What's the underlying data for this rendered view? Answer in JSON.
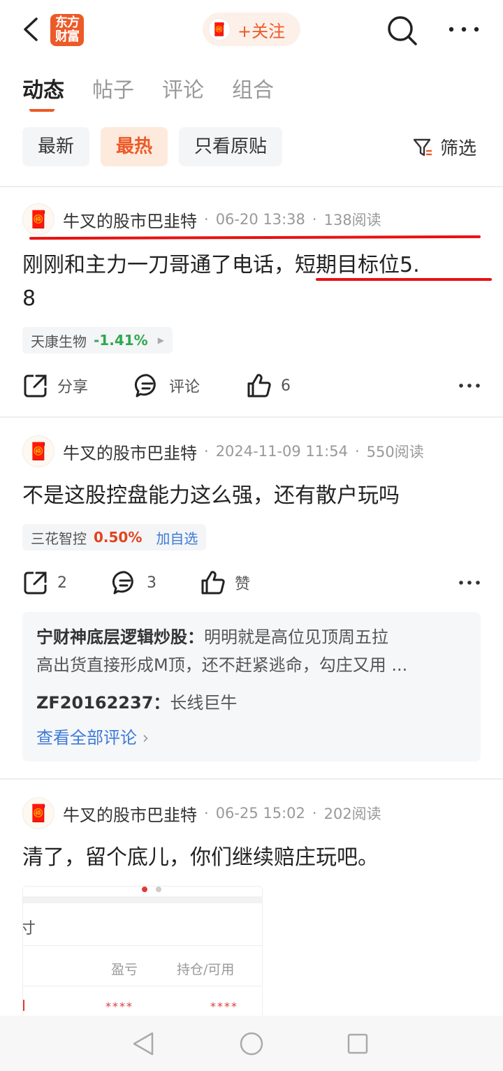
{
  "header": {
    "logo_text": "东方财富",
    "follow_label": "+关注"
  },
  "tabs": [
    {
      "label": "动态"
    },
    {
      "label": "帖子"
    },
    {
      "label": "评论"
    },
    {
      "label": "组合"
    }
  ],
  "filters": {
    "chips": [
      {
        "label": "最新"
      },
      {
        "label": "最热"
      },
      {
        "label": "只看原贴"
      }
    ],
    "filter_label": "筛选"
  },
  "posts": [
    {
      "author": "牛叉的股市巴韭特",
      "time": "06-20 13:38",
      "reads": "138阅读",
      "content_line1": "刚刚和主力一刀哥通了电话，短期目标位5.",
      "content_line2": "8",
      "stock_name": "天康生物",
      "stock_change": "-1.41%",
      "share_label": "分享",
      "comment_label": "评论",
      "like_count": "6"
    },
    {
      "author": "牛叉的股市巴韭特",
      "time": "2024-11-09 11:54",
      "reads": "550阅读",
      "content_line1": "不是这股控盘能力这么强，还有散户玩吗",
      "stock_name": "三花智控",
      "stock_change": "0.50%",
      "add_watch": "加自选",
      "share_count": "2",
      "comment_count": "3",
      "like_label": "赞",
      "comments": [
        {
          "name": "宁财神底层逻辑炒股：",
          "text_1": "明明就是高位见顶周五拉",
          "text_2": "高出货直接形成M顶，还不赶紧逃命，勾庄又用 ..."
        },
        {
          "name": "ZF20162237：",
          "text_1": "长线巨牛"
        }
      ],
      "view_all": "查看全部评论"
    },
    {
      "author": "牛叉的股市巴韭特",
      "time": "06-25 15:02",
      "reads": "202阅读",
      "content_line1": "清了，留个底儿，你们继续赔庄玩吧。",
      "image": {
        "col_1": "盈亏",
        "col_2": "持仓/可用",
        "val_1": "****",
        "val_2": "****",
        "cut_text": "寸"
      }
    }
  ]
}
